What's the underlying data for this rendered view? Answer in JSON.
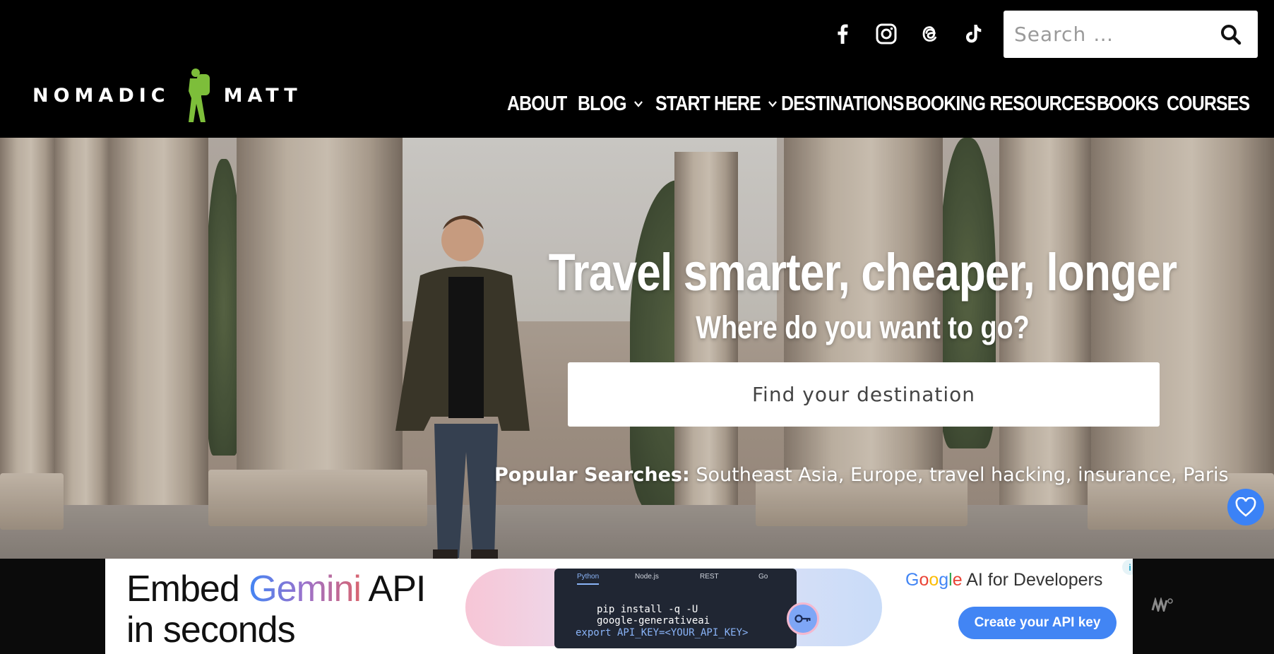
{
  "header": {
    "search": {
      "placeholder": "Search …"
    },
    "social_icons": [
      "facebook-icon",
      "instagram-icon",
      "threads-icon",
      "tiktok-icon"
    ],
    "logo": {
      "left_word": "NOMADIC",
      "right_word": "MATT",
      "figure_color": "#7dbe3a"
    },
    "nav": [
      {
        "label": "ABOUT",
        "dropdown": false
      },
      {
        "label": "BLOG",
        "dropdown": true
      },
      {
        "label": "START HERE",
        "dropdown": true
      },
      {
        "label": "DESTINATIONS",
        "dropdown": false
      },
      {
        "label": "BOOKING RESOURCES",
        "dropdown": true
      },
      {
        "label": "BOOKS",
        "dropdown": false
      },
      {
        "label": "COURSES",
        "dropdown": false
      }
    ]
  },
  "hero": {
    "title": "Travel smarter, cheaper, longer",
    "subtitle": "Where do you want to go?",
    "destination_placeholder": "Find your destination",
    "popular_label": "Popular Searches:",
    "popular_searches": [
      "Southeast Asia",
      "Europe",
      "travel hacking",
      "insurance",
      "Paris"
    ]
  },
  "ad": {
    "headline_1a": "Embed ",
    "headline_1b": "Gemini",
    "headline_1c": " API",
    "headline_2": "in seconds",
    "code_tabs": [
      "Python",
      "Node.js",
      "REST",
      "Go"
    ],
    "code_lines": [
      "pip install -q -U",
      "google-generativeai",
      "export API_KEY=<YOUR_API_KEY>"
    ],
    "brand_google": [
      "G",
      "o",
      "o",
      "g",
      "l",
      "e"
    ],
    "brand_rest": " AI for Developers",
    "cta_label": "Create your API key",
    "colors": {
      "google_blue": "#4285f4"
    }
  },
  "colors": {
    "header_bg": "#000000",
    "heart_button": "#3b82f6",
    "accent_green": "#7dbe3a"
  }
}
